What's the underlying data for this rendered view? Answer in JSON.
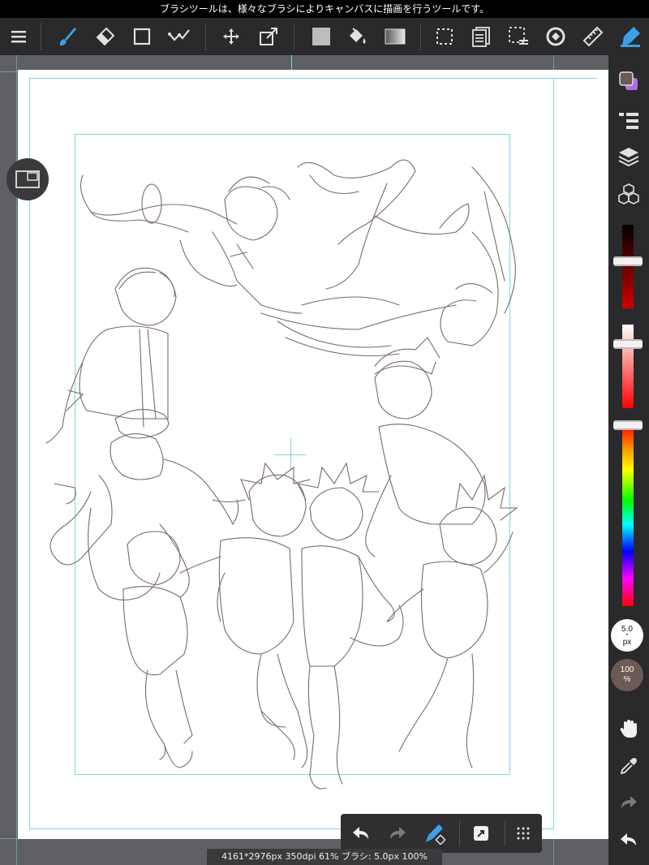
{
  "status_bar": {
    "message": "ブラシツールは、様々なブラシによりキャンバスに描画を行うツールです。"
  },
  "toolbar": {
    "menu_icon": "hamburger-icon",
    "tools": [
      {
        "name": "brush",
        "icon": "brush-icon",
        "active": true
      },
      {
        "name": "eraser",
        "icon": "eraser-icon"
      },
      {
        "name": "shape",
        "icon": "square-outline-icon"
      },
      {
        "name": "correction",
        "icon": "check-curve-icon"
      },
      {
        "name": "move",
        "icon": "move-arrows-icon"
      },
      {
        "name": "transform",
        "icon": "transform-icon"
      },
      {
        "name": "fill-color",
        "icon": "gray-square-icon"
      },
      {
        "name": "bucket",
        "icon": "paint-bucket-icon"
      },
      {
        "name": "gradient",
        "icon": "gradient-icon"
      },
      {
        "name": "select",
        "icon": "dashed-select-icon"
      },
      {
        "name": "layer-list",
        "icon": "stack-list-icon"
      },
      {
        "name": "select-menu",
        "icon": "select-list-icon"
      },
      {
        "name": "snap",
        "icon": "snap-circle-icon"
      },
      {
        "name": "ruler",
        "icon": "ruler-icon"
      },
      {
        "name": "pen-tip",
        "icon": "pen-tip-icon"
      }
    ]
  },
  "right_panel": {
    "colors": {
      "main": "#6d5a55",
      "sub": "#b070e0"
    },
    "brush_size": {
      "value": "5.0",
      "unit": "px"
    },
    "opacity": {
      "value": "100",
      "unit": "%"
    }
  },
  "floating_bar": {
    "items": [
      "undo-icon",
      "redo-icon",
      "brush-dropper-icon",
      "share-icon",
      "grid-icon"
    ]
  },
  "info_bar": {
    "text": "4161*2976px 350dpi 61% ブラシ: 5.0px 100%"
  }
}
